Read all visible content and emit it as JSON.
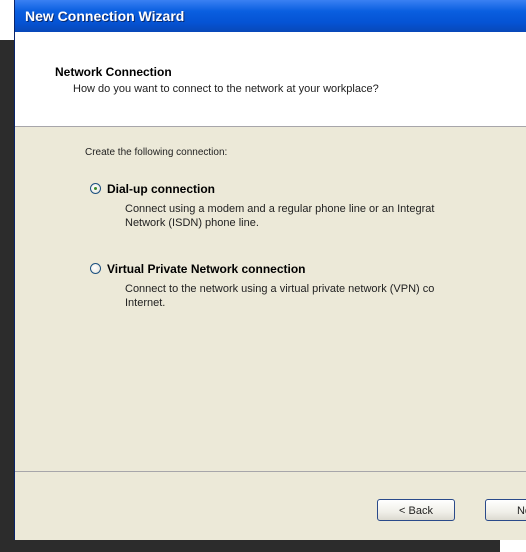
{
  "window": {
    "title": "New Connection Wizard"
  },
  "header": {
    "title": "Network Connection",
    "subtitle": "How do you want to connect to the network at your workplace?"
  },
  "body": {
    "intro": "Create the following connection:",
    "options": [
      {
        "label": "Dial-up connection",
        "selected": true,
        "description_lines": [
          "Connect using a modem and a regular phone line or an Integrat",
          "Network (ISDN) phone line."
        ]
      },
      {
        "label": "Virtual Private Network connection",
        "selected": false,
        "description_lines": [
          "Connect to the network using a virtual private network (VPN) co",
          "Internet."
        ]
      }
    ]
  },
  "footer": {
    "back_label": "< Back",
    "next_label": "Ne"
  },
  "colors": {
    "titlebar": "#0553d4",
    "dialog_bg": "#ece9d8",
    "header_bg": "#ffffff"
  }
}
